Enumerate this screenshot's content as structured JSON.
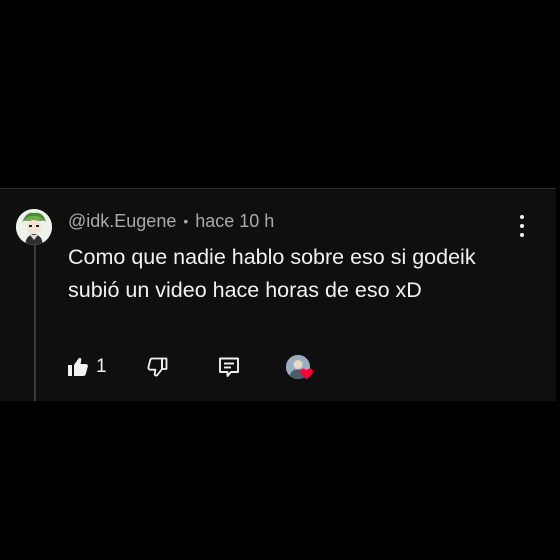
{
  "comment": {
    "author": "@idk.Eugene",
    "separator": "•",
    "timestamp": "hace 10 h",
    "text": "Como que nadie hablo sobre eso si godeik subió un video hace horas de eso xD",
    "avatar_icon": "anime-character-avatar",
    "more_icon": "more-vertical-icon"
  },
  "actions": {
    "like_count": "1",
    "like_icon": "thumbs-up-filled-icon",
    "dislike_icon": "thumbs-down-icon",
    "reply_icon": "reply-comment-icon",
    "creator_heart_icon": "creator-heart-icon"
  },
  "colors": {
    "background": "#000000",
    "card_background": "#0f0f0f",
    "text_primary": "#f1f1f1",
    "text_secondary": "#aaaaaa",
    "heart": "#ff0033"
  }
}
